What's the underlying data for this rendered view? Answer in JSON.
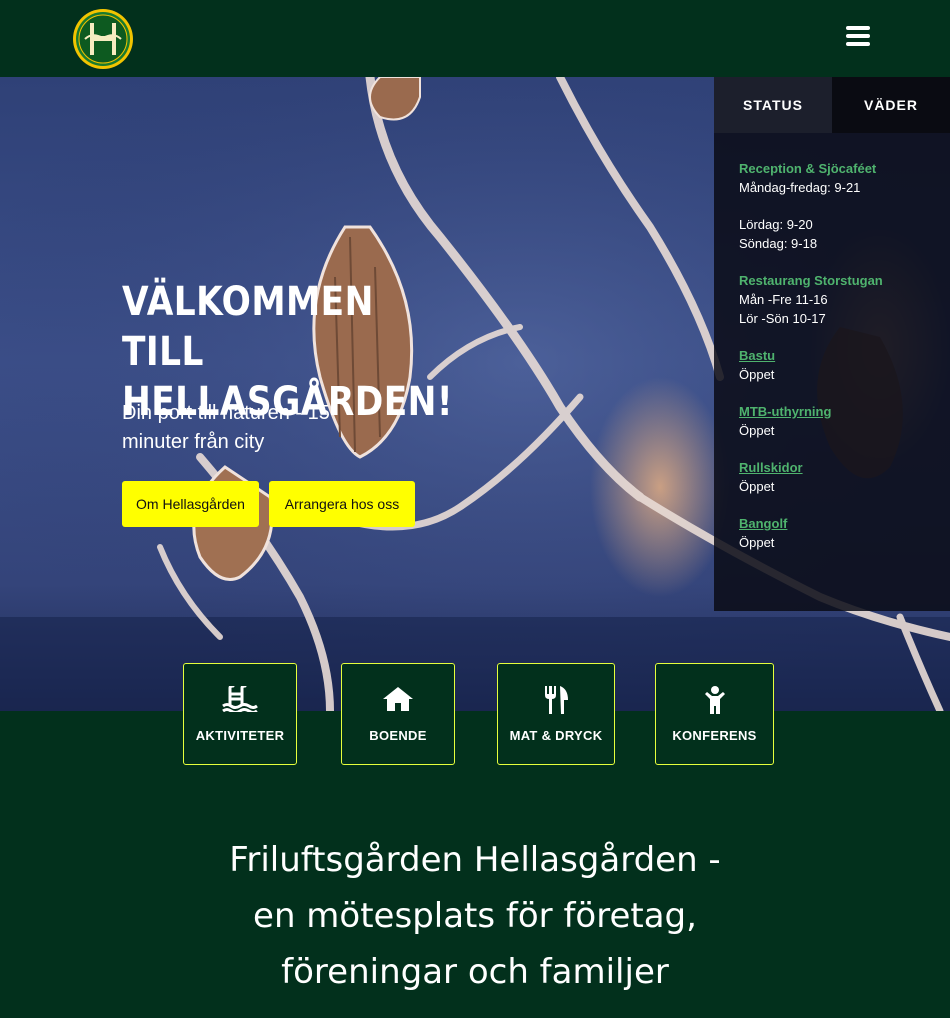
{
  "header": {
    "logo_icon": "hellasgarden-h-logo",
    "menu_icon": "hamburger-icon"
  },
  "hero": {
    "title": "VÄLKOMMEN TILL HELLASGÅRDEN!",
    "subtitle": "Din port till naturen - 15 minuter från city",
    "buttons": [
      "Om Hellasgården",
      "Arrangera hos oss"
    ],
    "button_color": "#ffff00"
  },
  "status_panel": {
    "tabs": [
      "STATUS",
      "VÄDER"
    ],
    "items": [
      {
        "title": "Reception & Sjöcaféet",
        "lines": [
          "Måndag-fredag: 9-21",
          "",
          "Lördag: 9-20",
          "Söndag: 9-18"
        ]
      },
      {
        "title": "Restaurang Storstugan",
        "lines": [
          "Mån -Fre 11-16",
          "Lör -Sön 10-17"
        ]
      },
      {
        "title": "Bastu",
        "lines": [
          "Öppet"
        ]
      },
      {
        "title": "MTB-uthyrning",
        "lines": [
          "Öppet"
        ]
      },
      {
        "title": "Rullskidor",
        "lines": [
          "Öppet"
        ]
      },
      {
        "title": "Bangolf",
        "lines": [
          "Öppet"
        ]
      }
    ],
    "accent_color": "#4fb36e"
  },
  "categories": [
    {
      "label": "AKTIVITETER",
      "icon": "swimming-pool-icon"
    },
    {
      "label": "BOENDE",
      "icon": "house-icon"
    },
    {
      "label": "MAT & DRYCK",
      "icon": "cutlery-icon"
    },
    {
      "label": "KONFERENS",
      "icon": "person-icon"
    }
  ],
  "headline": {
    "lines": [
      "Friluftsgården Hellasgården -",
      "en mötesplats för företag,",
      "föreningar och familjer"
    ]
  },
  "colors": {
    "dark_green": "#02301c",
    "card_border": "#e6ff3c"
  }
}
